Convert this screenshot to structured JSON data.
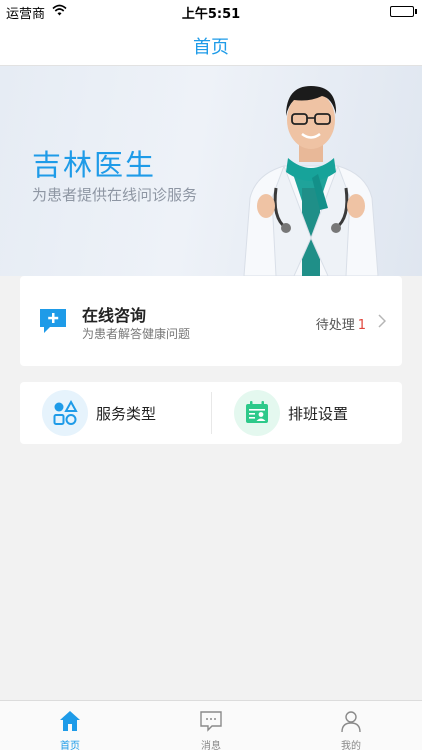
{
  "status_bar": {
    "carrier": "运营商",
    "time": "上午5:51"
  },
  "nav": {
    "title": "首页"
  },
  "banner": {
    "title": "吉林医生",
    "subtitle": "为患者提供在线问诊服务"
  },
  "consult": {
    "title": "在线咨询",
    "subtitle": "为患者解答健康问题",
    "pending_label": "待处理",
    "pending_count": "1",
    "icon": "chat-plus-icon"
  },
  "services": [
    {
      "label": "服务类型",
      "icon": "category-grid-icon"
    },
    {
      "label": "排班设置",
      "icon": "schedule-calendar-icon"
    }
  ],
  "tabs": [
    {
      "label": "首页",
      "icon": "home-icon",
      "active": true
    },
    {
      "label": "消息",
      "icon": "message-icon",
      "active": false
    },
    {
      "label": "我的",
      "icon": "user-icon",
      "active": false
    }
  ],
  "colors": {
    "accent": "#1e9be8",
    "green": "#2dc98a",
    "badge_red": "#e0453b"
  }
}
